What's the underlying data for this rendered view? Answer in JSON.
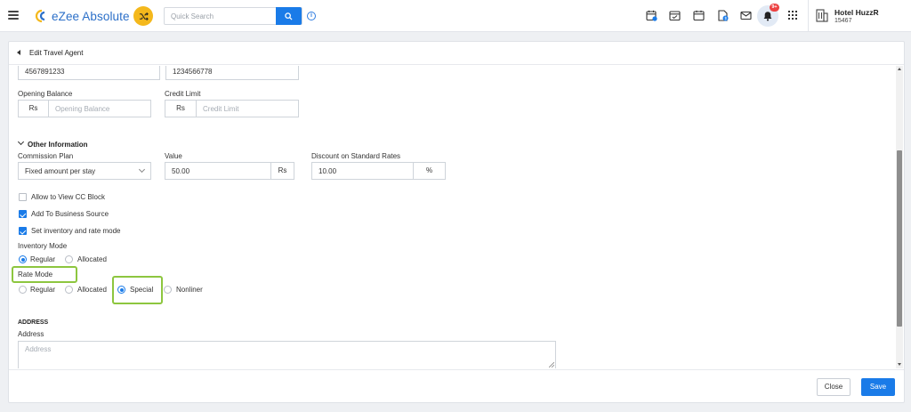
{
  "topbar": {
    "logo_text": "eZee Absolute",
    "search_placeholder": "Quick Search",
    "info_glyph": "i",
    "notification_badge": "9+",
    "hotel_name": "Hotel HuzzR",
    "hotel_id": "15467",
    "icons": [
      "menu-icon",
      "shuffle-icon",
      "search-icon",
      "info-icon",
      "calendar-icon",
      "reservation-icon",
      "calendar-grid-icon",
      "document-icon",
      "mail-icon",
      "bell-icon",
      "apps-grid-icon",
      "hotel-building-icon"
    ]
  },
  "panel": {
    "title": "Edit Travel Agent",
    "fields": {
      "phone1": "4567891233",
      "phone2": "1234566778",
      "opening_balance_label": "Opening Balance",
      "opening_balance_currency": "Rs",
      "opening_balance_placeholder": "Opening Balance",
      "credit_limit_label": "Credit Limit",
      "credit_limit_currency": "Rs",
      "credit_limit_placeholder": "Credit Limit"
    },
    "other_info": {
      "heading": "Other Information",
      "commission_plan_label": "Commission Plan",
      "commission_plan_value": "Fixed amount per stay",
      "value_label": "Value",
      "value_value": "50.00",
      "value_unit": "Rs",
      "discount_label": "Discount on Standard Rates",
      "discount_value": "10.00",
      "discount_unit": "%"
    },
    "checkboxes": [
      {
        "label": "Allow to View CC Block",
        "checked": false
      },
      {
        "label": "Add To Business Source",
        "checked": true
      },
      {
        "label": "Set inventory and rate mode",
        "checked": true
      }
    ],
    "inventory_mode": {
      "label": "Inventory Mode",
      "options": [
        "Regular",
        "Allocated"
      ],
      "selected": "Regular"
    },
    "rate_mode": {
      "label": "Rate Mode",
      "options": [
        "Regular",
        "Allocated",
        "Special",
        "Nonliner"
      ],
      "selected": "Special"
    },
    "address": {
      "heading": "ADDRESS",
      "label": "Address",
      "placeholder": "Address"
    }
  },
  "footer": {
    "close_label": "Close",
    "save_label": "Save"
  },
  "colors": {
    "accent": "#1a7be8",
    "highlight": "#8dc63f",
    "shuffle": "#f4b81c",
    "badge": "#ec4242"
  }
}
